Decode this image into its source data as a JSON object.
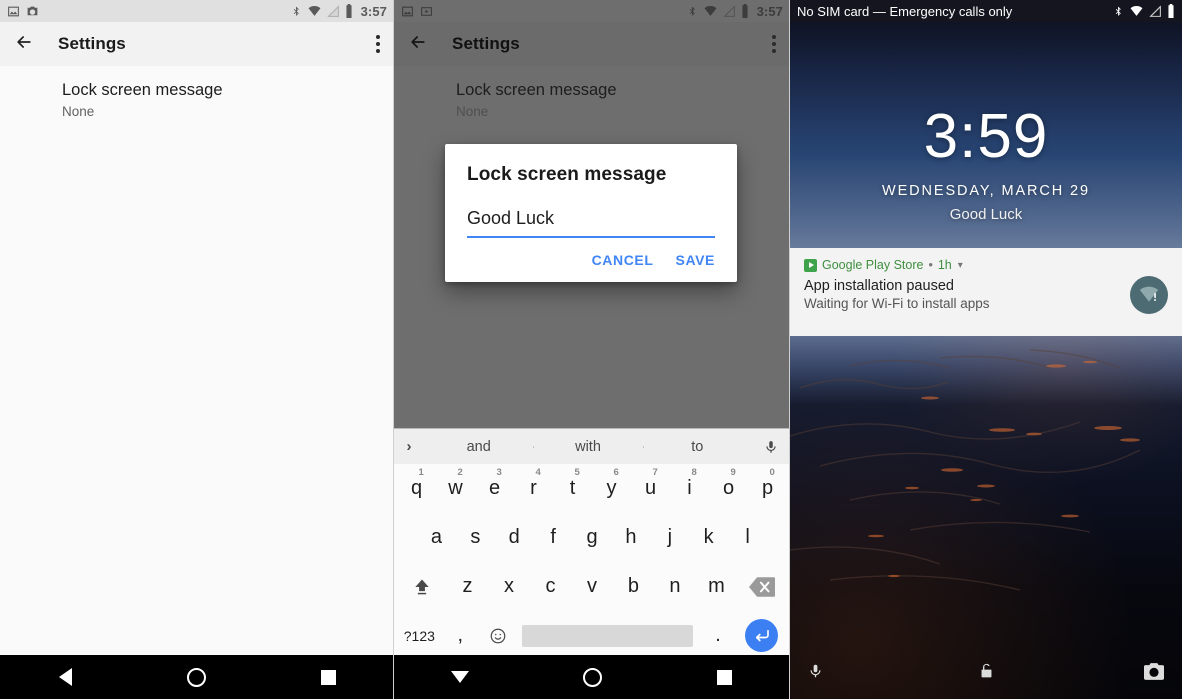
{
  "panel_settings": {
    "statusbar": {
      "left_icons": [
        "image-icon",
        "screenshot-icon"
      ],
      "right_icons": [
        "bluetooth-icon",
        "wifi-off-icon",
        "signal-off-icon",
        "battery-icon"
      ],
      "clock": "3:57"
    },
    "appbar": {
      "back": "back-arrow-icon",
      "title": "Settings",
      "overflow": "more-options-icon"
    },
    "preference": {
      "title": "Lock screen message",
      "summary": "None"
    },
    "navbar": {
      "back": "back-triangle-icon",
      "home": "home-circle-icon",
      "recents": "recents-square-icon"
    }
  },
  "panel_dialog": {
    "statusbar": {
      "left_icons": [
        "image-icon",
        "video-icon"
      ],
      "right_icons": [
        "bluetooth-icon",
        "wifi-off-icon",
        "signal-off-icon",
        "battery-icon"
      ],
      "clock": "3:57"
    },
    "appbar": {
      "back": "back-arrow-icon",
      "title": "Settings",
      "overflow": "more-options-icon"
    },
    "preference": {
      "title": "Lock screen message",
      "summary": "None"
    },
    "dialog": {
      "title": "Lock screen message",
      "input_value": "Good Luck",
      "input_placeholder": "",
      "cancel_label": "CANCEL",
      "save_label": "SAVE",
      "accent_color": "#4285f4"
    },
    "keyboard": {
      "suggestions": [
        "and",
        "with",
        "to"
      ],
      "expand_icon": "chevron-right-icon",
      "mic_icon": "microphone-icon",
      "row1": [
        {
          "key": "q",
          "num": "1"
        },
        {
          "key": "w",
          "num": "2"
        },
        {
          "key": "e",
          "num": "3"
        },
        {
          "key": "r",
          "num": "4"
        },
        {
          "key": "t",
          "num": "5"
        },
        {
          "key": "y",
          "num": "6"
        },
        {
          "key": "u",
          "num": "7"
        },
        {
          "key": "i",
          "num": "8"
        },
        {
          "key": "o",
          "num": "9"
        },
        {
          "key": "p",
          "num": "0"
        }
      ],
      "row2": [
        "a",
        "s",
        "d",
        "f",
        "g",
        "h",
        "j",
        "k",
        "l"
      ],
      "row3": [
        "z",
        "x",
        "c",
        "v",
        "b",
        "n",
        "m"
      ],
      "shift_icon": "shift-icon",
      "backspace_icon": "backspace-icon",
      "symbols_label": "?123",
      "comma_label": ",",
      "emoji_icon": "emoji-icon",
      "space_label": "",
      "period_label": ".",
      "enter_icon": "enter-icon"
    },
    "navbar": {
      "back": "down-triangle-icon",
      "home": "home-circle-icon",
      "recents": "recents-square-icon"
    }
  },
  "panel_lockscreen": {
    "statusbar": {
      "carrier": "No SIM card — Emergency calls only",
      "right_icons": [
        "bluetooth-icon",
        "wifi-off-icon",
        "signal-off-icon",
        "battery-icon"
      ]
    },
    "clock": "3:59",
    "date": "WEDNESDAY, MARCH 29",
    "lock_message": "Good Luck",
    "notification": {
      "app_name": "Google Play Store",
      "separator": "•",
      "time": "1h",
      "expand_icon": "chevron-down-icon",
      "title": "App installation paused",
      "body": "Waiting for Wi-Fi to install apps",
      "badge_icon": "wifi-alert-icon",
      "app_color": "#3f8f3f"
    },
    "shortcuts": {
      "left": "microphone-icon",
      "center": "unlock-icon",
      "right": "camera-icon"
    }
  }
}
